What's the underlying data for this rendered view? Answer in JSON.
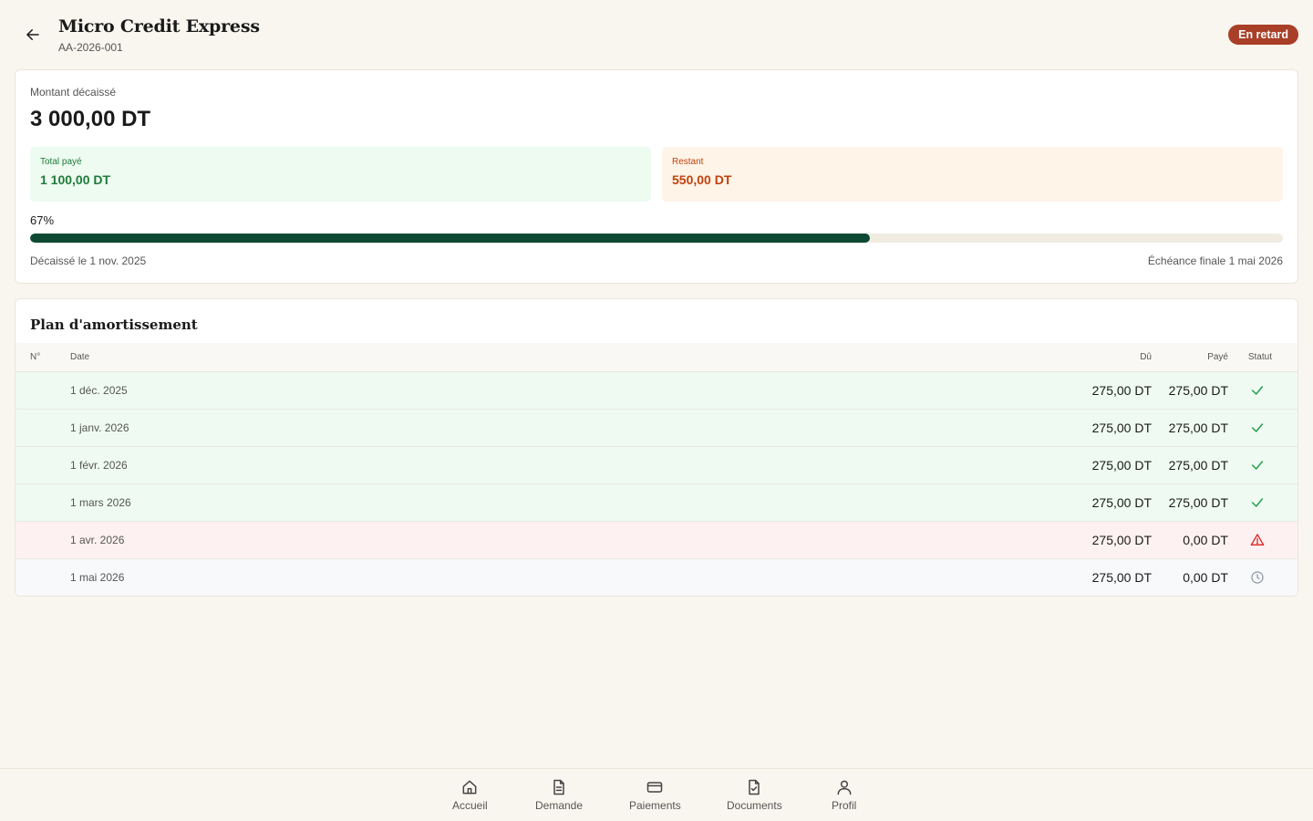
{
  "header": {
    "title": "Micro Credit Express",
    "reference": "AA-2026-001",
    "status_badge": "En retard"
  },
  "summary": {
    "disbursed_label": "Montant décaissé",
    "disbursed_amount": "3 000,00 DT",
    "total_paid_label": "Total payé",
    "total_paid_value": "1 100,00 DT",
    "remaining_label": "Restant",
    "remaining_value": "550,00 DT",
    "progress_text": "67%",
    "progress_fraction": 0.67,
    "disbursed_date": "Décaissé le 1 nov. 2025",
    "final_due_date": "Échéance finale 1 mai 2026"
  },
  "schedule": {
    "title": "Plan d'amortissement",
    "columns": {
      "number": "N°",
      "date": "Date",
      "due": "Dû",
      "paid": "Payé",
      "status": "Statut"
    },
    "rows": [
      {
        "date": "1 déc. 2025",
        "due": "275,00 DT",
        "paid": "275,00 DT",
        "status": "paid"
      },
      {
        "date": "1 janv. 2026",
        "due": "275,00 DT",
        "paid": "275,00 DT",
        "status": "paid"
      },
      {
        "date": "1 févr. 2026",
        "due": "275,00 DT",
        "paid": "275,00 DT",
        "status": "paid"
      },
      {
        "date": "1 mars 2026",
        "due": "275,00 DT",
        "paid": "275,00 DT",
        "status": "paid"
      },
      {
        "date": "1 avr. 2026",
        "due": "275,00 DT",
        "paid": "0,00 DT",
        "status": "late"
      },
      {
        "date": "1 mai 2026",
        "due": "275,00 DT",
        "paid": "0,00 DT",
        "status": "pending"
      }
    ]
  },
  "nav": {
    "items": [
      {
        "label": "Accueil",
        "icon": "home-icon"
      },
      {
        "label": "Demande",
        "icon": "document-icon"
      },
      {
        "label": "Paiements",
        "icon": "credit-card-icon"
      },
      {
        "label": "Documents",
        "icon": "file-check-icon"
      },
      {
        "label": "Profil",
        "icon": "user-icon"
      }
    ]
  },
  "colors": {
    "background": "#f9f6ef",
    "badge": "#a93f27",
    "progress_fill": "#0e4a33",
    "paid_green": "#1f7a3a",
    "remaining_orange": "#c2410c",
    "late_red": "#dc2626"
  }
}
